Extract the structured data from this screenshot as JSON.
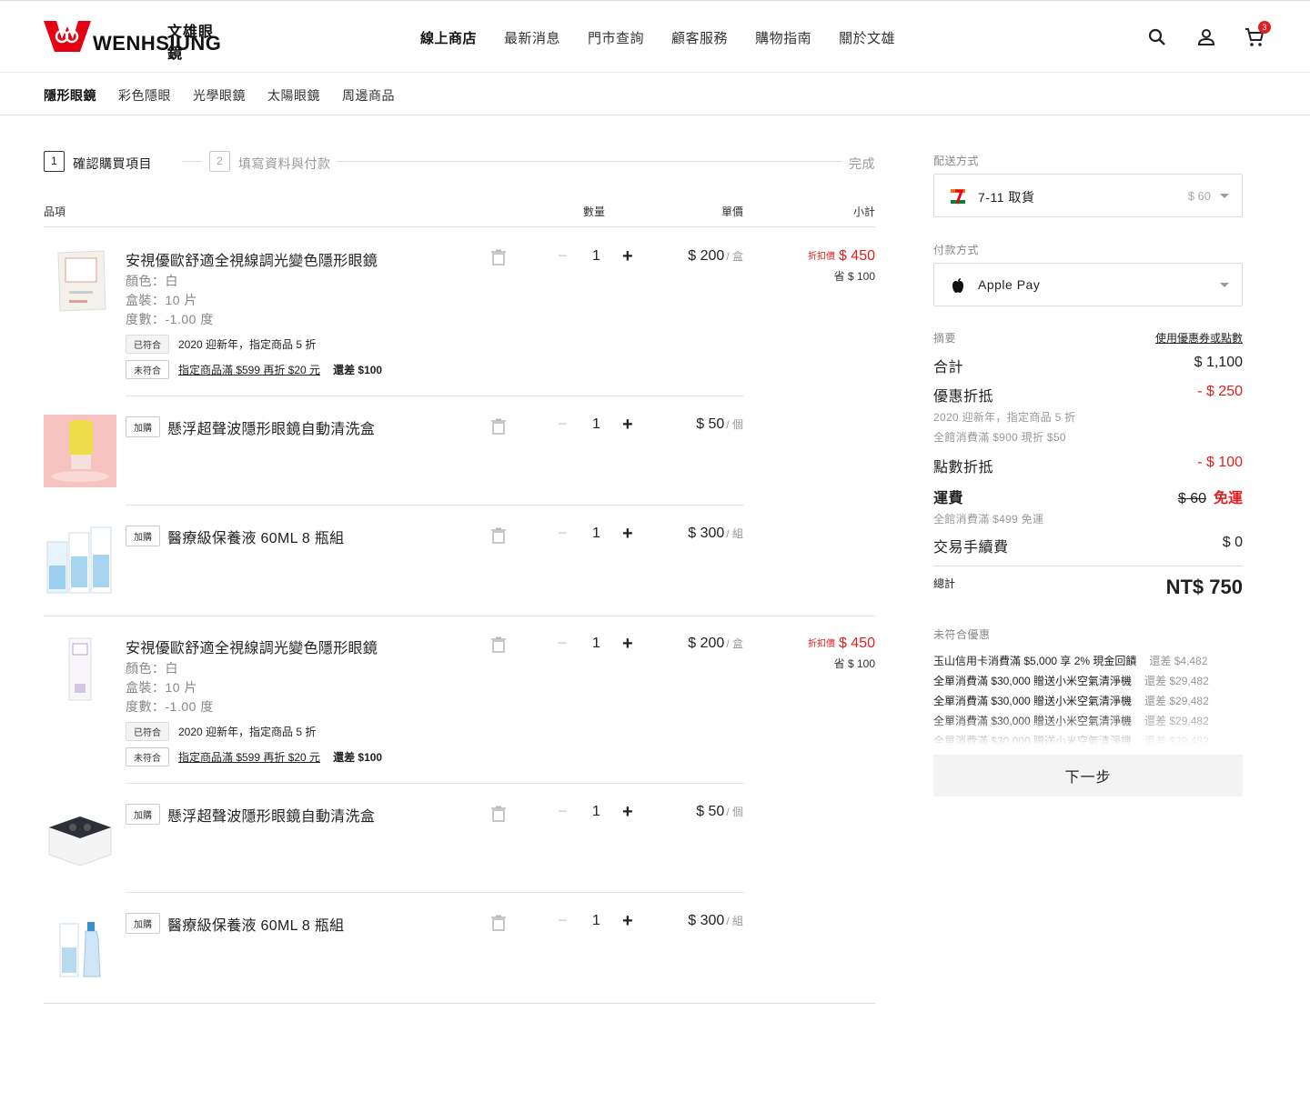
{
  "brand": {
    "name_cn": "文雄眼鏡",
    "name_en": "WENHSIUNG"
  },
  "mainnav": [
    "線上商店",
    "最新消息",
    "門市查詢",
    "顧客服務",
    "購物指南",
    "關於文雄"
  ],
  "cart_count": "3",
  "subnav": [
    "隱形眼鏡",
    "彩色隱眼",
    "光學眼鏡",
    "太陽眼鏡",
    "周邊商品"
  ],
  "steps": [
    {
      "num": "1",
      "label": "確認購買項目"
    },
    {
      "num": "2",
      "label": "填寫資料與付款"
    },
    {
      "label": "完成"
    }
  ],
  "table_head": {
    "item": "品項",
    "qty": "數量",
    "unit_price": "單價",
    "subtotal": "小計"
  },
  "items": [
    {
      "title": "安視優歐舒適全視線調光變色隱形眼鏡",
      "color": "顏色：白",
      "box": "盒裝：10 片",
      "power": "度數：-1.00 度",
      "tag1_chip": "已符合",
      "tag1_text": "2020 迎新年，指定商品 5 折",
      "tag2_chip": "未符合",
      "tag2_text": "指定商品滿 $599 再折 $20 元",
      "tag2_gap": "還差 $100",
      "qty": "1",
      "price": "$ 200",
      "unit": "/ 盒",
      "discount_label": "折扣價",
      "discount_value": "$ 450",
      "save": "省 $ 100"
    },
    {
      "chip": "加購",
      "title": "懸浮超聲波隱形眼鏡自動清洗盒",
      "qty": "1",
      "price": "$ 50",
      "unit": "/ 個"
    },
    {
      "chip": "加購",
      "title": "醫療級保養液 60ML 8 瓶組",
      "qty": "1",
      "price": "$ 300",
      "unit": "/ 組"
    },
    {
      "title": "安視優歐舒適全視線調光變色隱形眼鏡",
      "color": "顏色：白",
      "box": "盒裝：10 片",
      "power": "度數：-1.00 度",
      "tag1_chip": "已符合",
      "tag1_text": "2020 迎新年，指定商品 5 折",
      "tag2_chip": "未符合",
      "tag2_text": "指定商品滿 $599 再折 $20 元",
      "tag2_gap": "還差 $100",
      "qty": "1",
      "price": "$ 200",
      "unit": "/ 盒",
      "discount_label": "折扣價",
      "discount_value": "$ 450",
      "save": "省 $ 100"
    },
    {
      "chip": "加購",
      "title": "懸浮超聲波隱形眼鏡自動清洗盒",
      "qty": "1",
      "price": "$ 50",
      "unit": "/ 個"
    },
    {
      "chip": "加購",
      "title": "醫療級保養液 60ML 8 瓶組",
      "qty": "1",
      "price": "$ 300",
      "unit": "/ 組"
    }
  ],
  "qty_minus": "−",
  "qty_plus": "+",
  "shipping": {
    "label": "配送方式",
    "value": "7-11 取貨",
    "price": "$ 60",
    "icon": "seven-eleven-icon"
  },
  "payment": {
    "label": "付款方式",
    "value": "Apple Pay",
    "icon": "apple-icon"
  },
  "summary": {
    "label": "摘要",
    "coupon_link": "使用優惠券或點數",
    "subtotal_label": "合計",
    "subtotal_value": "$ 1,100",
    "discount_label": "優惠折抵",
    "discount_value": "- $ 250",
    "discount_note1": "2020 迎新年，指定商品 5 折",
    "discount_note2": "全館消費滿 $900 現折 $50",
    "points_label": "點數折抵",
    "points_value": "- $ 100",
    "shipping_label": "運費",
    "shipping_old": "$ 60",
    "shipping_free": "免運",
    "shipping_note": "全館消費滿 $499 免運",
    "fee_label": "交易手續費",
    "fee_value": "$ 0",
    "total_label": "總計",
    "total_value": "NT$ 750"
  },
  "unmet": {
    "label": "未符合優惠",
    "items": [
      {
        "text": "玉山信用卡消費滿 $5,000 享 2% 現金回饋",
        "gap": "還差 $4,482"
      },
      {
        "text": "全單消費滿 $30,000 贈送小米空氣清淨機",
        "gap": "還差 $29,482"
      },
      {
        "text": "全單消費滿 $30,000 贈送小米空氣清淨機",
        "gap": "還差 $29,482"
      },
      {
        "text": "全單消費滿 $30,000 贈送小米空氣清淨機",
        "gap": "還差 $29,482"
      },
      {
        "text": "全單消費滿 $30,000 贈送小米空氣清淨機",
        "gap": "還差 $29,482"
      }
    ]
  },
  "next_button": "下一步",
  "colors": {
    "accent_red": "#e02020",
    "brand_red": "#e60012"
  }
}
